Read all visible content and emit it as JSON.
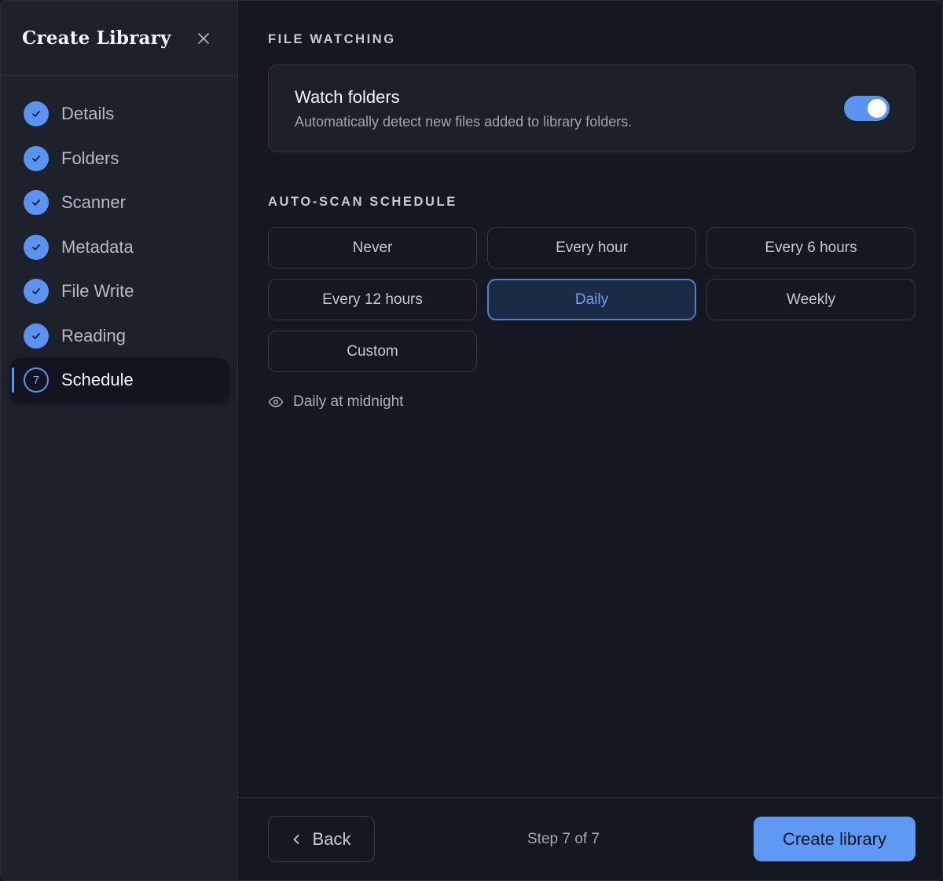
{
  "sidebar": {
    "title": "Create Library",
    "steps": [
      {
        "label": "Details",
        "state": "done"
      },
      {
        "label": "Folders",
        "state": "done"
      },
      {
        "label": "Scanner",
        "state": "done"
      },
      {
        "label": "Metadata",
        "state": "done"
      },
      {
        "label": "File Write",
        "state": "done"
      },
      {
        "label": "Reading",
        "state": "done"
      },
      {
        "label": "Schedule",
        "state": "active",
        "number": "7"
      }
    ]
  },
  "file_watching": {
    "section_label": "FILE WATCHING",
    "title": "Watch folders",
    "description": "Automatically detect new files added to library folders.",
    "enabled": true
  },
  "schedule": {
    "section_label": "AUTO-SCAN SCHEDULE",
    "options": [
      "Never",
      "Every hour",
      "Every 6 hours",
      "Every 12 hours",
      "Daily",
      "Weekly",
      "Custom"
    ],
    "selected": "Daily",
    "summary": "Daily at midnight"
  },
  "footer": {
    "back_label": "Back",
    "step_text": "Step 7 of 7",
    "create_label": "Create library"
  },
  "colors": {
    "accent": "#5b93f0",
    "background": "#151821",
    "sidebar": "#1d212b"
  }
}
